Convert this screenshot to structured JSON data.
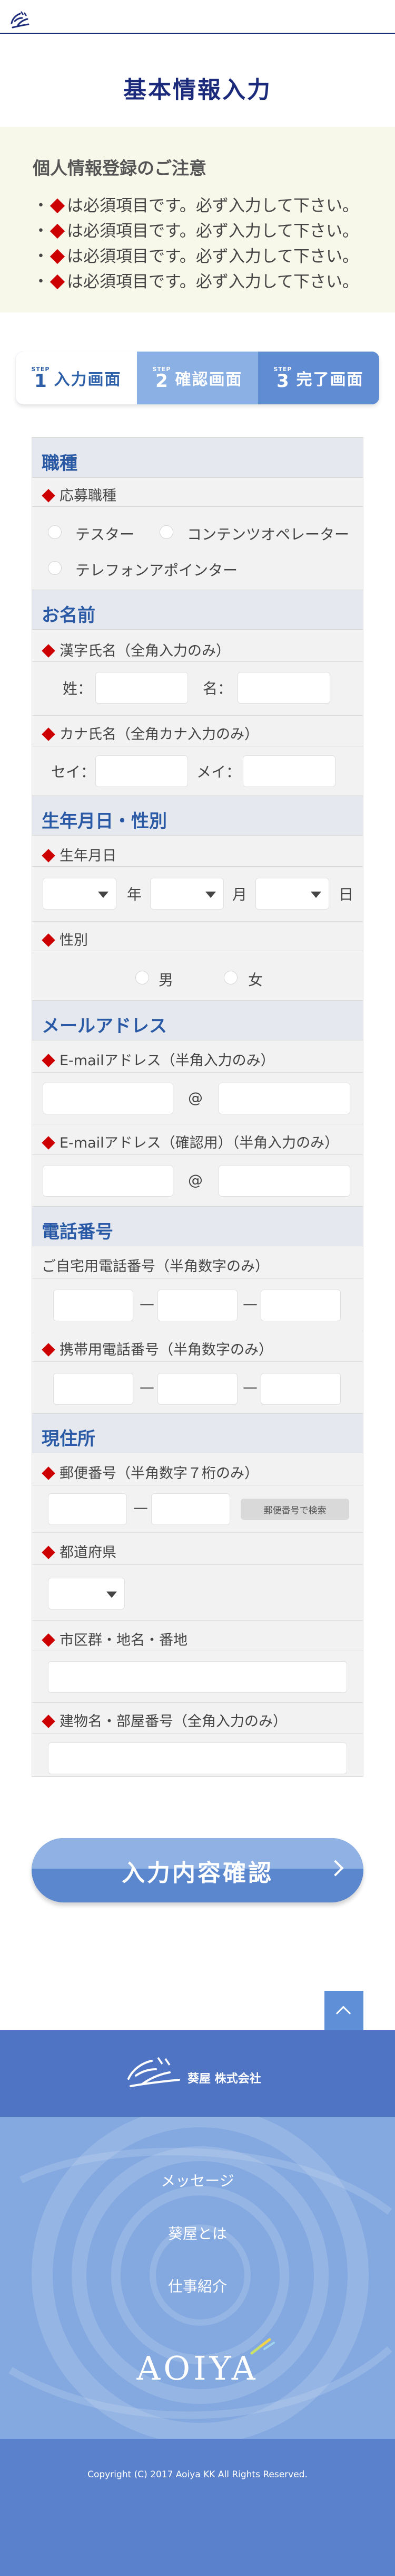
{
  "header": {
    "logo_text": "葵屋"
  },
  "page_title": "基本情報入力",
  "notice": {
    "title": "個人情報登録のご注意",
    "lines": [
      "は必須項目です。必ず入力して下さい。",
      "は必須項目です。必ず入力して下さい。",
      "は必須項目です。必ず入力して下さい。",
      "は必須項目です。必ず入力して下さい。"
    ]
  },
  "steps": [
    {
      "word": "STEP",
      "num": "1",
      "label": "入力画面",
      "active": true
    },
    {
      "word": "STEP",
      "num": "2",
      "label": "確認画面",
      "active": false
    },
    {
      "word": "STEP",
      "num": "3",
      "label": "完了画面",
      "active": false
    }
  ],
  "form": {
    "job": {
      "heading": "職種",
      "label": "応募職種",
      "options": [
        "テスター",
        "コンテンツオペレーター",
        "テレフォンアポインター"
      ]
    },
    "name": {
      "heading": "お名前",
      "kanji_label": "漢字氏名（全角入力のみ）",
      "sei": "姓：",
      "mei": "名：",
      "kana_label": "カナ氏名（全角カナ入力のみ）",
      "kana_sei": "セイ：",
      "kana_mei": "メイ："
    },
    "birth": {
      "heading": "生年月日・性別",
      "birth_label": "生年月日",
      "year": "年",
      "month": "月",
      "day": "日",
      "gender_label": "性別",
      "male": "男",
      "female": "女"
    },
    "email": {
      "heading": "メールアドレス",
      "label": "E-mailアドレス（半角入力のみ）",
      "confirm_label": "E-mailアドレス（確認用）（半角入力のみ）",
      "at": "@"
    },
    "phone": {
      "heading": "電話番号",
      "home_label": "ご自宅用電話番号（半角数字のみ）",
      "mobile_label": "携帯用電話番号（半角数字のみ）",
      "sep": "—"
    },
    "address": {
      "heading": "現住所",
      "zip_label": "郵便番号（半角数字７桁のみ）",
      "zip_sep": "—",
      "zip_button": "郵便番号で検索",
      "pref_label": "都道府県",
      "city_label": "市区群・地名・番地",
      "building_label": "建物名・部屋番号（全角入力のみ）"
    }
  },
  "confirm_button": "入力内容確認",
  "footer": {
    "logo_text": "葵屋",
    "company": "葵屋 株式会社",
    "nav": [
      "メッセージ",
      "葵屋とは",
      "仕事紹介"
    ],
    "brand": "AOIYA",
    "copyright": "Copyright (C) 2017 Aoiya KK All Rights Reserved."
  },
  "colors": {
    "navy": "#1b2a7a",
    "required": "#cc0000",
    "accent_blue": "#2a5aa5",
    "footer_blue": "#5a82cc"
  }
}
